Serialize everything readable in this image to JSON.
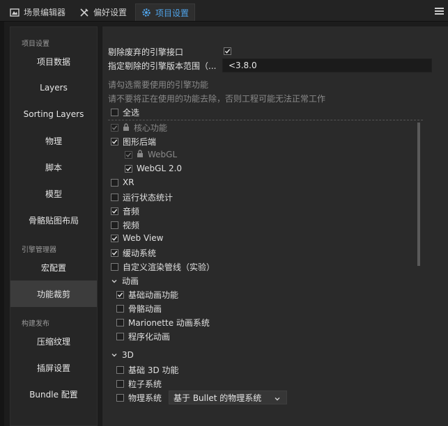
{
  "tabs": [
    {
      "label": "场景编辑器",
      "icon": "scene-editor-icon"
    },
    {
      "label": "偏好设置",
      "icon": "tools-icon"
    },
    {
      "label": "项目设置",
      "icon": "gear-icon",
      "active": true
    }
  ],
  "sidebar": {
    "sections": {
      "project": "项目设置",
      "engine": "引擎管理器",
      "build": "构建发布"
    },
    "items": [
      {
        "label": "项目数据"
      },
      {
        "label": "Layers"
      },
      {
        "label": "Sorting Layers"
      },
      {
        "label": "物理"
      },
      {
        "label": "脚本"
      },
      {
        "label": "模型"
      },
      {
        "label": "骨骼贴图布局"
      },
      {
        "label": "宏配置"
      },
      {
        "label": "功能裁剪",
        "active": true
      },
      {
        "label": "压缩纹理"
      },
      {
        "label": "插屏设置"
      },
      {
        "label": "Bundle 配置"
      }
    ]
  },
  "main": {
    "remove_deprecated_label": "剔除废弃的引擎接口",
    "remove_deprecated_checked": true,
    "version_range_label": "指定剔除的引擎版本范围（...",
    "version_range_value": "<3.8.0",
    "hint1": "请勾选需要使用的引擎功能",
    "hint2": "请不要将正在使用的功能去除，否则工程可能无法正常工作",
    "select_all": "全选",
    "features": {
      "core": "核心功能",
      "graphics": "图形后端",
      "webgl": "WebGL",
      "webgl2": "WebGL 2.0",
      "xr": "XR",
      "profiler": "运行状态统计",
      "audio": "音频",
      "video": "视频",
      "webview": "Web View",
      "tween": "缓动系统",
      "custom_pipeline": "自定义渲染管线（实验）"
    },
    "animation_group": {
      "title": "动画",
      "items": [
        "基础动画功能",
        "骨骼动画",
        "Marionette 动画系统",
        "程序化动画"
      ]
    },
    "group_3d": {
      "title": "3D",
      "items": [
        "基础 3D 功能",
        "粒子系统",
        "物理系统"
      ]
    },
    "physics_engine_select": "基于 Bullet 的物理系统"
  },
  "colors": {
    "accent": "#4fa3e8",
    "background": "#1c1c1c",
    "panel": "#2a2a2a",
    "sidebar": "#262626"
  }
}
